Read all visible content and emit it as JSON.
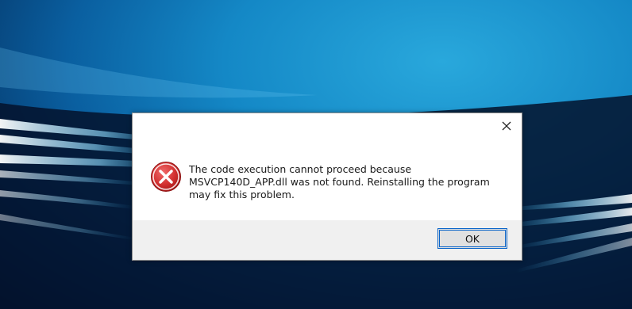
{
  "dialog": {
    "message_lines": [
      "The code execution cannot proceed because",
      "MSVCP140D_APP.dll was not found. Reinstalling the program",
      "may fix this problem."
    ],
    "ok_label": "OK",
    "close_icon": "close-icon",
    "error_icon": "error-icon"
  },
  "colors": {
    "error_red": "#d22f2f",
    "button_border": "#0a64c8",
    "footer_bg": "#f0f0f0"
  }
}
